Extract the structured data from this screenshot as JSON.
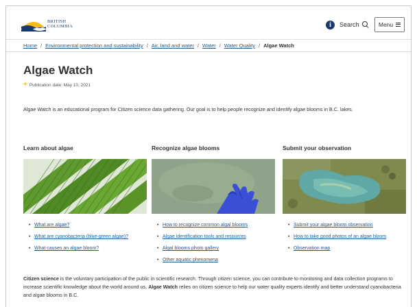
{
  "header": {
    "logo_line1": "BRITISH",
    "logo_line2": "COLUMBIA",
    "search_label": "Search",
    "menu_label": "Menu"
  },
  "breadcrumb": [
    "Home",
    "Environmental protection and sustainability",
    "Air, land and water",
    "Water",
    "Water Quality",
    "Algae Watch"
  ],
  "page": {
    "title": "Algae Watch",
    "publication_date": "Publication date: May 10, 2021",
    "intro": "Algae Watch is an educational program for Citizen science data gathering. Our goal is to help people recognize and identify algae blooms in B.C. lakes."
  },
  "columns": [
    {
      "title": "Learn about algae",
      "image": "algae-microscope-image",
      "links": [
        "What are algae?",
        "What are cyanobacteria (blue-green algae)?",
        "What causes an algae bloom?"
      ]
    },
    {
      "title": "Recognize algae blooms",
      "image": "gloved-hand-water-image",
      "links": [
        "How to recognize common algal blooms",
        "Algae identification tools and resources",
        "Algal blooms photo gallery",
        "Other aquatic phenomena"
      ]
    },
    {
      "title": "Submit your observation",
      "image": "aerial-lake-image",
      "links": [
        "Submit your algae bloom observation",
        "How to take good photos of an algae bloom",
        "Observation map"
      ]
    }
  ],
  "citizen_science": {
    "term": "Citizen science",
    "text_1": " is the voluntary participation of the public in scientific research. Through citizen science, you can contribute to monitoring and data collection programs to increase scientific knowledge about the world around us. ",
    "program": "Algae Watch",
    "text_2": " relies on citizen science to help our water quality experts identify and better understand cyanobacteria and algae blooms in B.C."
  },
  "colors": {
    "link": "#1a5a96",
    "text": "#313132",
    "accent_gold": "#fcba19",
    "brand_navy": "#1a3a6c"
  }
}
